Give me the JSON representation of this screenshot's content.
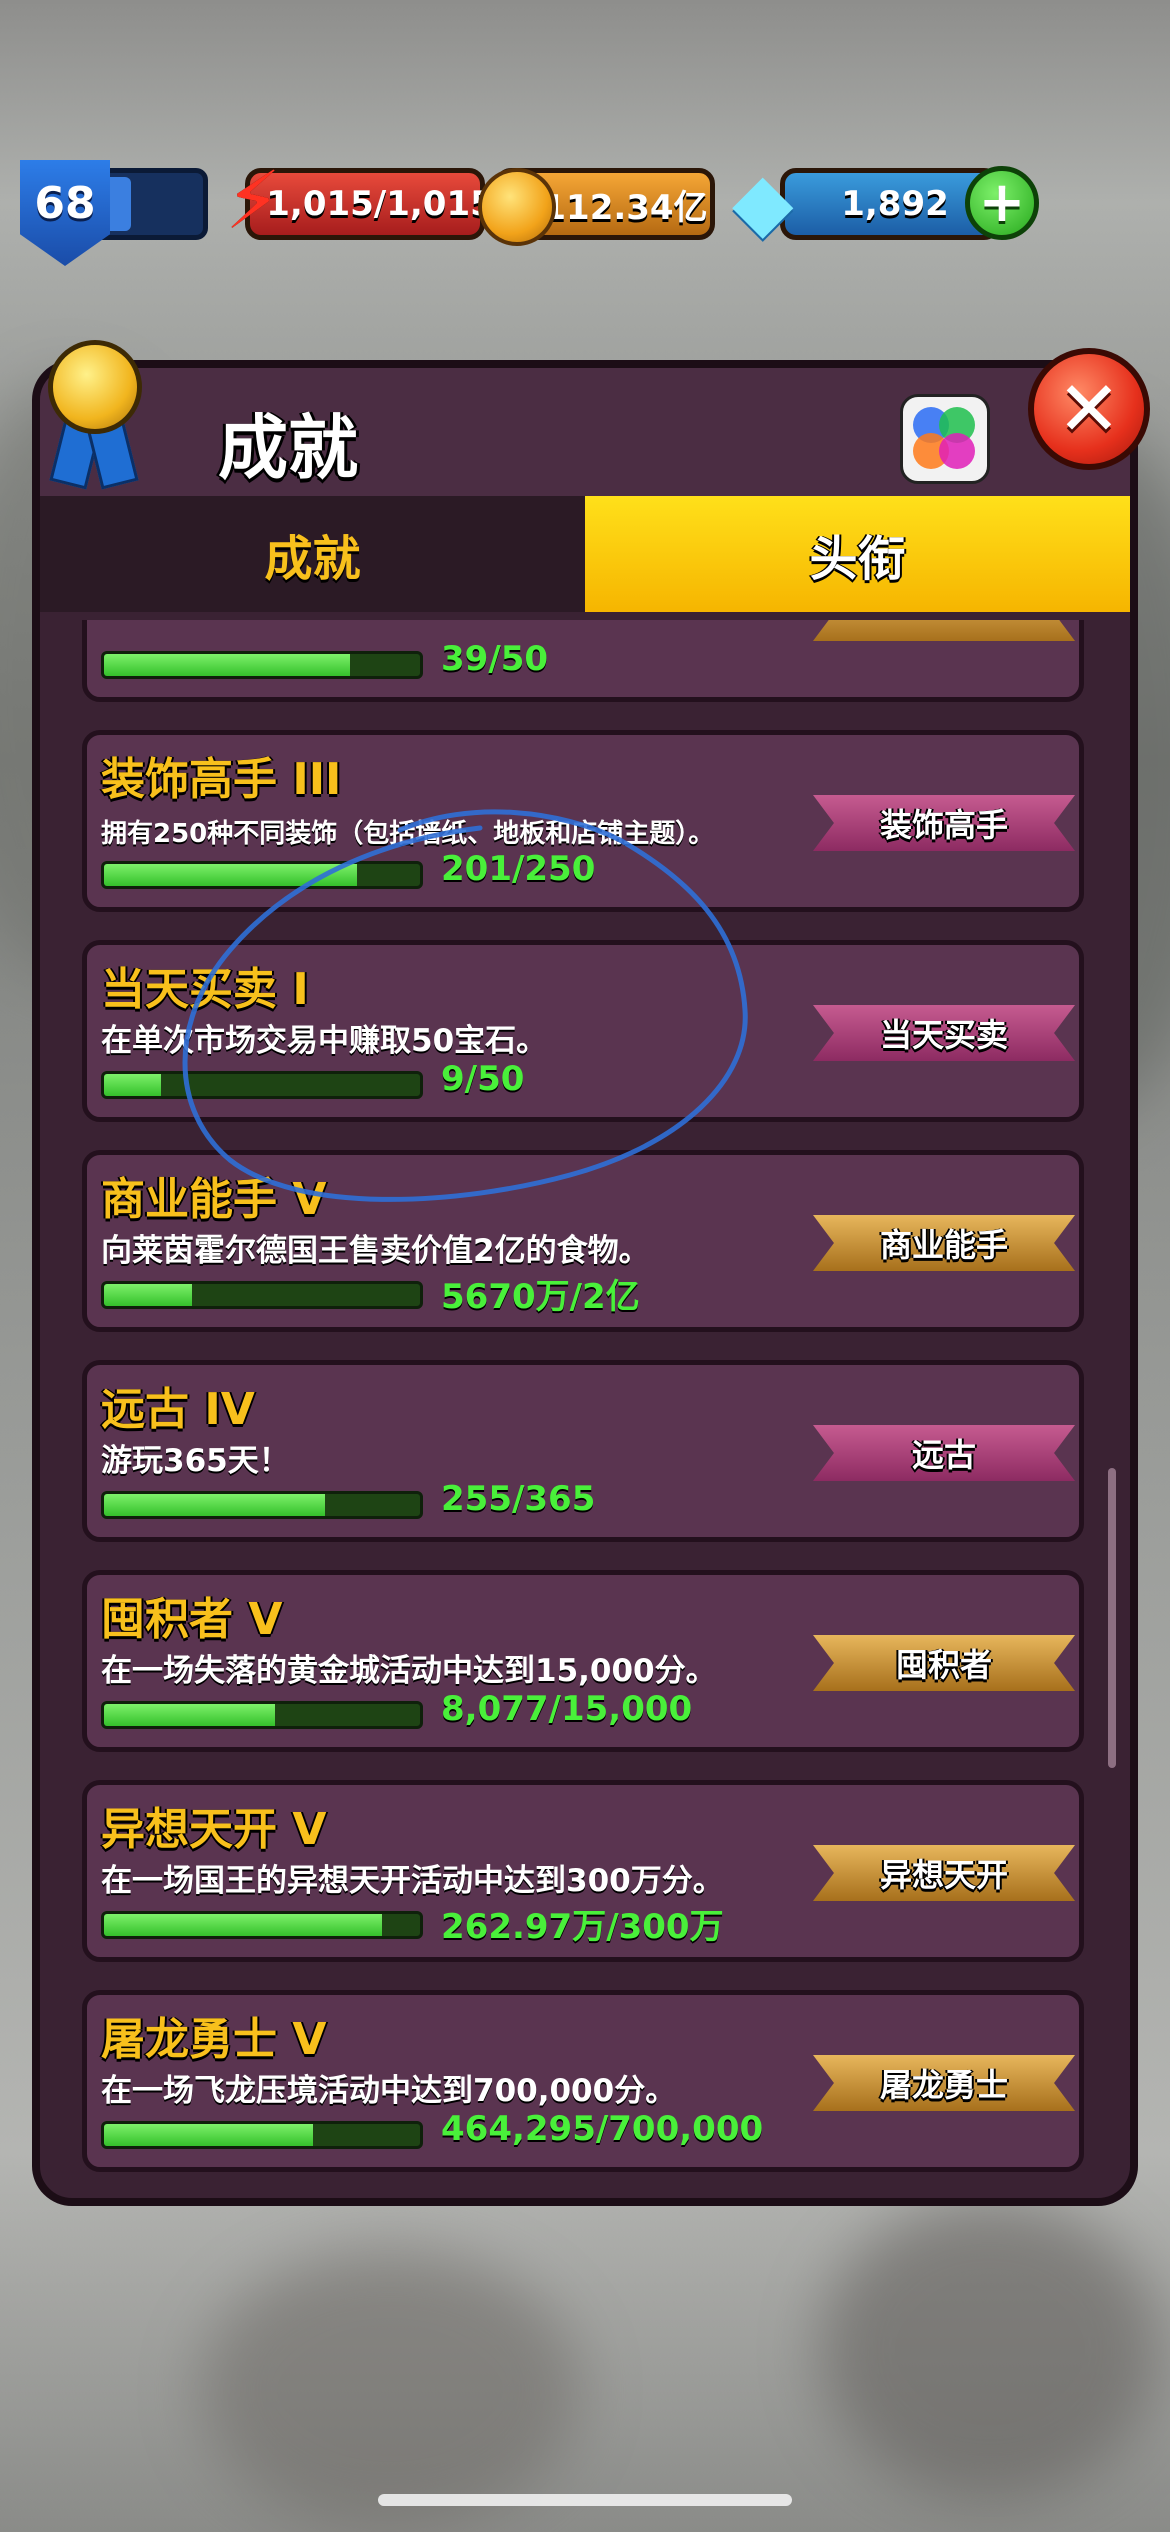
{
  "hud": {
    "level": "68",
    "energy": "1,015/1,015",
    "gold": "112.34亿",
    "gems": "1,892",
    "plus_symbol": "+"
  },
  "panel": {
    "title": "成就",
    "close_symbol": "✕",
    "tabs": [
      {
        "label": "成就",
        "active": false
      },
      {
        "label": "头衔",
        "active": true
      }
    ]
  },
  "achievements": [
    {
      "name": "",
      "desc": "",
      "progress_text": "39/50",
      "progress": 0.78,
      "ribbon": "",
      "ribbon_style": "gold"
    },
    {
      "name": "装饰高手 III",
      "desc": "拥有250种不同装饰（包括墙纸、地板和店铺主题）。",
      "progress_text": "201/250",
      "progress": 0.8,
      "ribbon": "装饰高手",
      "ribbon_style": "pink"
    },
    {
      "name": "当天买卖 I",
      "desc": "在单次市场交易中赚取50宝石。",
      "progress_text": "9/50",
      "progress": 0.18,
      "ribbon": "当天买卖",
      "ribbon_style": "pink"
    },
    {
      "name": "商业能手 V",
      "desc": "向莱茵霍尔德国王售卖价值2亿的食物。",
      "progress_text": "5670万/2亿",
      "progress": 0.28,
      "ribbon": "商业能手",
      "ribbon_style": "gold"
    },
    {
      "name": "远古 IV",
      "desc": "游玩365天！",
      "progress_text": "255/365",
      "progress": 0.7,
      "ribbon": "远古",
      "ribbon_style": "pink"
    },
    {
      "name": "囤积者 V",
      "desc": "在一场失落的黄金城活动中达到15,000分。",
      "progress_text": "8,077/15,000",
      "progress": 0.54,
      "ribbon": "囤积者",
      "ribbon_style": "gold"
    },
    {
      "name": "异想天开 V",
      "desc": "在一场国王的异想天开活动中达到300万分。",
      "progress_text": "262.97万/300万",
      "progress": 0.88,
      "ribbon": "异想天开",
      "ribbon_style": "gold"
    },
    {
      "name": "屠龙勇士 V",
      "desc": "在一场飞龙压境活动中达到700,000分。",
      "progress_text": "464,295/700,000",
      "progress": 0.66,
      "ribbon": "屠龙勇士",
      "ribbon_style": "gold"
    }
  ],
  "colors": {
    "accent_yellow": "#f8c01c",
    "progress_green": "#49f03a",
    "annotation_blue": "#2f6fd6"
  }
}
